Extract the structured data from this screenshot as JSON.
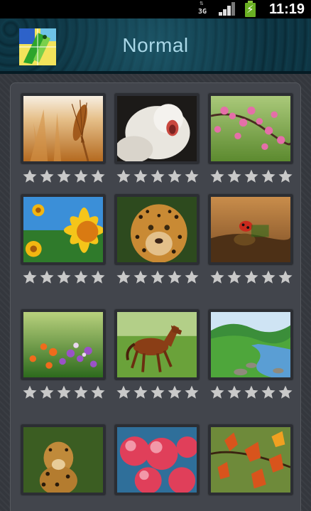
{
  "status_bar": {
    "network": "3G",
    "time": "11:19",
    "signal_level": 3,
    "battery_charging": true
  },
  "header": {
    "title": "Normal",
    "icon": "app-logo-icon"
  },
  "colors": {
    "header_text": "#a9d7e7",
    "star_color": "#c9c9c9",
    "panel": "#42454c"
  },
  "wallpapers": [
    {
      "subject": "wheat",
      "rating": 0
    },
    {
      "subject": "white-lion",
      "rating": 0
    },
    {
      "subject": "cherry-blossom",
      "rating": 0
    },
    {
      "subject": "sunflower",
      "rating": 0
    },
    {
      "subject": "jaguar",
      "rating": 0
    },
    {
      "subject": "ladybug",
      "rating": 0
    },
    {
      "subject": "flowers",
      "rating": 0
    },
    {
      "subject": "horse",
      "rating": 0
    },
    {
      "subject": "river",
      "rating": 0
    },
    {
      "subject": "leopard",
      "rating": 0
    },
    {
      "subject": "red-berries",
      "rating": 0
    },
    {
      "subject": "autumn-leaves",
      "rating": 0
    }
  ]
}
